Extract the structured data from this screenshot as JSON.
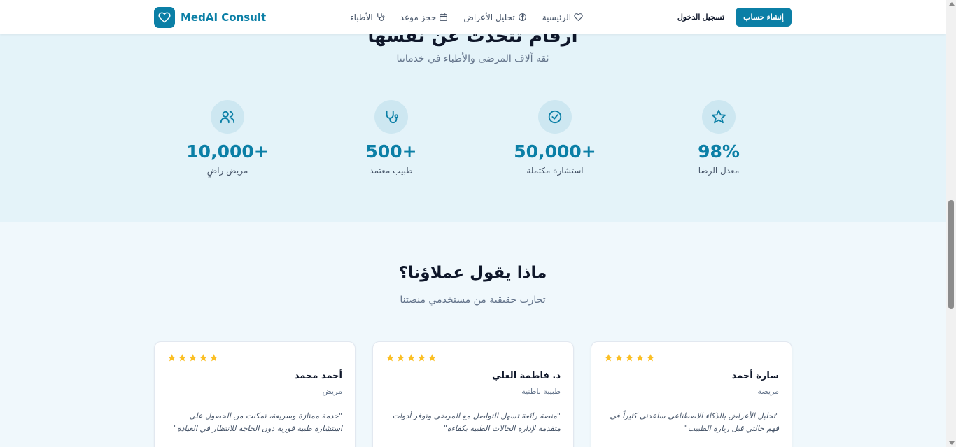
{
  "nav": {
    "logo_text": "MedAI Consult",
    "links": [
      {
        "label": "الرئيسية",
        "icon": "heart-icon"
      },
      {
        "label": "تحليل الأعراض",
        "icon": "brain-icon"
      },
      {
        "label": "حجز موعد",
        "icon": "calendar-icon"
      },
      {
        "label": "الأطباء",
        "icon": "stethoscope-icon"
      }
    ],
    "login_label": "تسجيل الدخول",
    "signup_label": "إنشاء حساب"
  },
  "stats": {
    "title": "أرقام تتحدث عن نفسها",
    "subtitle": "ثقة آلاف المرضى والأطباء في خدماتنا",
    "items": [
      {
        "value": "98%",
        "label": "معدل الرضا",
        "icon": "star-icon"
      },
      {
        "value": "50,000+",
        "label": "استشارة مكتملة",
        "icon": "check-circle-icon"
      },
      {
        "value": "500+",
        "label": "طبيب معتمد",
        "icon": "stethoscope-icon"
      },
      {
        "value": "10,000+",
        "label": "مريض راضٍ",
        "icon": "users-icon"
      }
    ]
  },
  "testimonials": {
    "title": "ماذا يقول عملاؤنا؟",
    "subtitle": "تجارب حقيقية من مستخدمي منصتنا",
    "cards": [
      {
        "rating": 5,
        "name": "سارة أحمد",
        "role": "مريضة",
        "quote": "\"تحليل الأعراض بالذكاء الاصطناعي ساعدني كثيراً في فهم حالتي قبل زيارة الطبيب\""
      },
      {
        "rating": 5,
        "name": "د. فاطمة العلي",
        "role": "طبيبة باطنية",
        "quote": "\"منصة رائعة تسهل التواصل مع المرضى وتوفر أدوات متقدمة لإدارة الحالات الطبية بكفاءة\""
      },
      {
        "rating": 5,
        "name": "أحمد محمد",
        "role": "مريض",
        "quote": "\"خدمة ممتازة وسريعة، تمكنت من الحصول على استشارة طبية فورية دون الحاجة للانتظار في العيادة\""
      }
    ]
  },
  "colors": {
    "brand": "#0b7fa6",
    "star": "#fbbf24"
  }
}
